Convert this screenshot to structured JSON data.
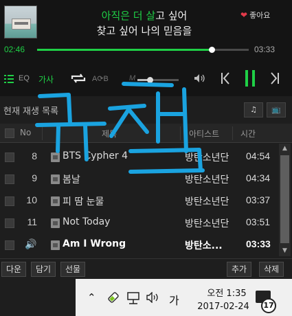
{
  "player": {
    "lyric_line1_sung": "아직은 더 살",
    "lyric_line1_rest": "고 싶어",
    "lyric_line2": "찾고 싶어 나의 믿음을",
    "like_label": "좋아요",
    "like_icon": "heart-icon",
    "elapsed": "02:46",
    "total": "03:33",
    "progress": 0.825,
    "volume": 0.3,
    "colors": {
      "accent": "#1fd046",
      "heart": "#e23a4a"
    }
  },
  "controls": {
    "list_icon": "list-icon",
    "eq_label": "EQ",
    "lyrics_label": "가사",
    "repeat_icon": "repeat-icon",
    "ab_label": "A⟳B",
    "mute_label": "M",
    "speaker_icon": "speaker-icon",
    "prev_icon": "previous-icon",
    "pause_icon": "pause-icon",
    "next_icon": "next-icon"
  },
  "playlist": {
    "title": "현재 재생 목록",
    "columns": {
      "no": "No",
      "title": "제목",
      "artist": "아티스트",
      "time": "시간"
    },
    "rows": [
      {
        "no": "8",
        "title": "BTS Cypher 4",
        "artist": "방탄소년단",
        "time": "04:54"
      },
      {
        "no": "9",
        "title": "봄날",
        "artist": "방탄소년단",
        "time": "04:34"
      },
      {
        "no": "10",
        "title": "피 땀 눈물",
        "artist": "방탄소년단",
        "time": "03:37"
      },
      {
        "no": "11",
        "title": "Not Today",
        "artist": "방탄소년단",
        "time": "03:51"
      },
      {
        "no": "",
        "title": "Am I Wrong",
        "artist": "방탄소...",
        "time": "03:33",
        "playing": true
      }
    ]
  },
  "bottom": {
    "download": "다운",
    "add": "담기",
    "gift": "선물",
    "add_more": "추가",
    "delete": "삭제"
  },
  "taskbar": {
    "ime": "가",
    "time": "오전 1:35",
    "date": "2017-02-24",
    "notification_count": "17"
  },
  "overlay": {
    "handwriting": "귀찮"
  }
}
